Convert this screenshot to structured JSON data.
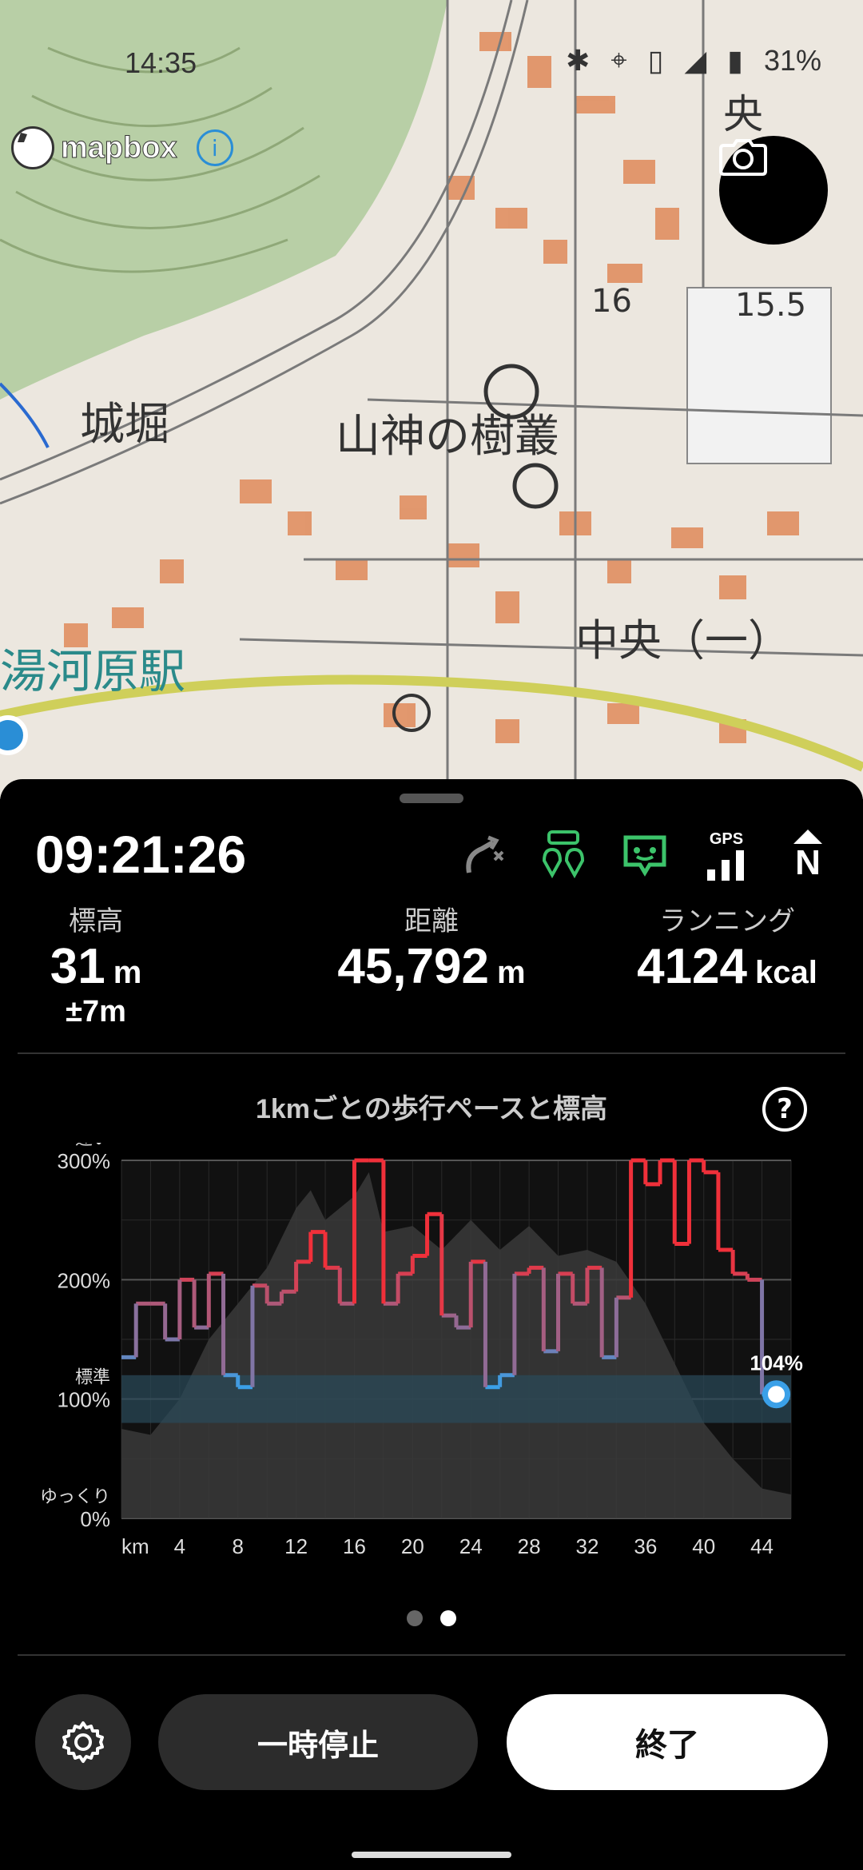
{
  "status": {
    "time": "14:35",
    "battery": "31%"
  },
  "map": {
    "attribution": "mapbox",
    "labels": {
      "place1": "城堀",
      "place2": "山神の樹叢",
      "station": "湯河原駅",
      "district": "中央（一）",
      "height1": "16",
      "height2": "15.5",
      "kanji_top": "央"
    }
  },
  "sheet": {
    "clock": "09:21:26",
    "gps_label": "GPS",
    "north_label": "N",
    "stats": [
      {
        "label": "標高",
        "value": "31",
        "unit": "m",
        "sub": "±7m"
      },
      {
        "label": "距離",
        "value": "45,792",
        "unit": "m"
      },
      {
        "label": "ランニング",
        "value": "4124",
        "unit": "kcal"
      }
    ],
    "chart_title": "1kmごとの歩行ペースと標高",
    "help_label": "?"
  },
  "chart_data": {
    "type": "line",
    "title": "1kmごとの歩行ペースと標高",
    "xlabel": "km",
    "x_ticks": [
      4,
      8,
      12,
      16,
      20,
      24,
      28,
      32,
      36,
      40,
      44
    ],
    "y_ticks": [
      "300%",
      "200%",
      "100%",
      "0%"
    ],
    "y_words": {
      "fast": "速い",
      "standard": "標準",
      "slow": "ゆっくり"
    },
    "ylim": [
      0,
      300
    ],
    "xlim": [
      0,
      46
    ],
    "pace_series": {
      "name": "歩行ペース",
      "x": [
        0,
        1,
        2,
        3,
        4,
        5,
        6,
        7,
        8,
        9,
        10,
        11,
        12,
        13,
        14,
        15,
        16,
        17,
        18,
        19,
        20,
        21,
        22,
        23,
        24,
        25,
        26,
        27,
        28,
        29,
        30,
        31,
        32,
        33,
        34,
        35,
        36,
        37,
        38,
        39,
        40,
        41,
        42,
        43,
        44
      ],
      "values": [
        135,
        180,
        180,
        150,
        200,
        160,
        205,
        120,
        110,
        195,
        180,
        190,
        215,
        240,
        210,
        180,
        300,
        300,
        180,
        205,
        220,
        255,
        170,
        160,
        215,
        110,
        120,
        205,
        210,
        140,
        205,
        180,
        210,
        135,
        185,
        300,
        280,
        300,
        230,
        300,
        290,
        225,
        205,
        200,
        104
      ]
    },
    "elevation_profile": {
      "name": "標高",
      "x": [
        0,
        2,
        4,
        6,
        8,
        10,
        12,
        13,
        14,
        16,
        17,
        18,
        20,
        22,
        24,
        26,
        28,
        30,
        32,
        34,
        36,
        38,
        40,
        42,
        44,
        46
      ],
      "values": [
        75,
        70,
        100,
        150,
        180,
        210,
        260,
        275,
        250,
        270,
        290,
        240,
        245,
        225,
        250,
        225,
        245,
        220,
        225,
        215,
        180,
        130,
        80,
        50,
        25,
        20
      ]
    },
    "standard_band": [
      80,
      120
    ],
    "current_label": "104%",
    "grid": true,
    "colors": {
      "pace_fast": "#f0303a",
      "pace_slow": "#3aa0e8",
      "band": "#2a4a5a"
    }
  },
  "page_dots": [
    {
      "active": false
    },
    {
      "active": true
    }
  ],
  "controls": {
    "pause_label": "一時停止",
    "end_label": "終了"
  }
}
